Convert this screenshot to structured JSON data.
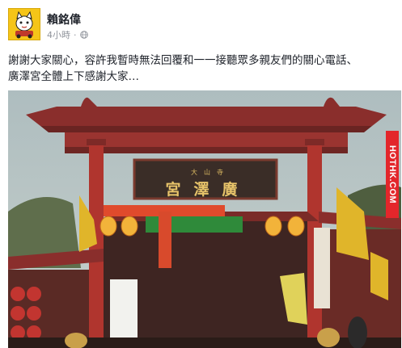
{
  "post": {
    "author": "賴銘偉",
    "time": "4小時",
    "separator": "·",
    "privacy_icon": "globe-icon",
    "text_line1": "謝謝大家關心，容許我暫時無法回覆和一一接聽眾多親友們的關心電話、",
    "text_line2": "廣澤宮全體上下感謝大家…"
  },
  "photo": {
    "sign_main": "宮澤廣",
    "sign_small": "大山寺",
    "watermark": "HOTHK.COM"
  },
  "colors": {
    "roof": "#8a2e2c",
    "pillar": "#b0352e",
    "watermark_bg": "#e3262b",
    "sign_gold": "#e8c46a"
  }
}
